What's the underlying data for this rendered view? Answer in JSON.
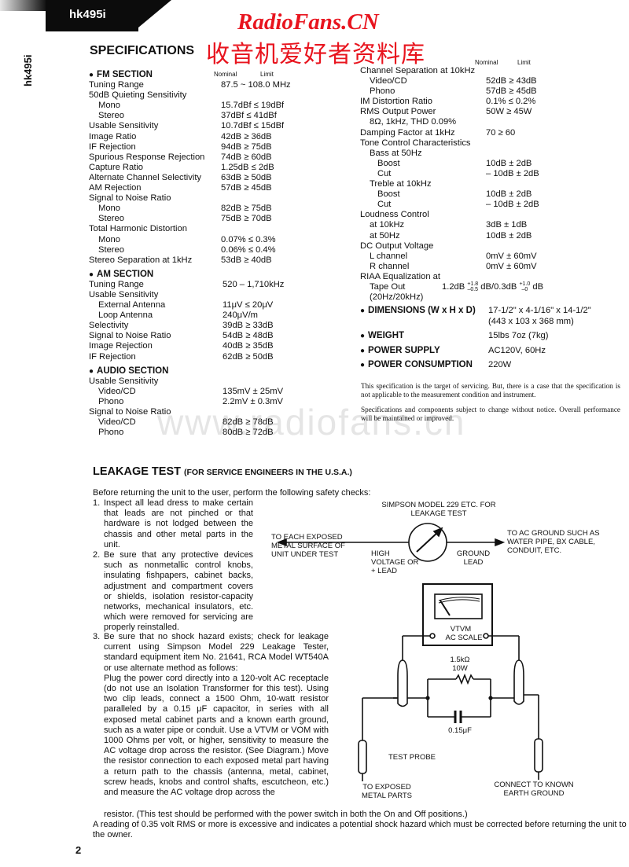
{
  "header": {
    "model_tab": "hk495i",
    "model_vertical": "hk495i",
    "title": "SPECIFICATIONS",
    "watermark_title": "RadioFans.CN",
    "watermark_cn": "收音机爱好者资料库",
    "watermark_url": "www.radiofans.cn"
  },
  "columns": {
    "nominal": "Nominal",
    "limit": "Limit"
  },
  "fm_section": {
    "title": "FM SECTION",
    "rows": [
      {
        "label": "Tuning Range",
        "value": "87.5 ~ 108.0 MHz",
        "indent": 0
      },
      {
        "label": "50dB Quieting Sensitivity",
        "value": "",
        "indent": 0
      },
      {
        "label": "Mono",
        "value": "15.7dBf ≤ 19dBf",
        "indent": 1
      },
      {
        "label": "Stereo",
        "value": "37dBf ≤ 41dBf",
        "indent": 1
      },
      {
        "label": "Usable Sensitivity",
        "value": "10.7dBf ≤ 15dBf",
        "indent": 0
      },
      {
        "label": "Image Ratio",
        "value": "42dB ≥ 36dB",
        "indent": 0
      },
      {
        "label": "IF Rejection",
        "value": "94dB ≥ 75dB",
        "indent": 0
      },
      {
        "label": "Spurious Response Rejection",
        "value": "74dB ≥ 60dB",
        "indent": 0
      },
      {
        "label": "Capture Ratio",
        "value": "1.25dB ≤ 2dB",
        "indent": 0
      },
      {
        "label": "Alternate Channel Selectivity",
        "value": "63dB ≥ 50dB",
        "indent": 0
      },
      {
        "label": "AM Rejection",
        "value": "57dB ≥ 45dB",
        "indent": 0
      },
      {
        "label": "Signal to Noise Ratio",
        "value": "",
        "indent": 0
      },
      {
        "label": "Mono",
        "value": "82dB ≥ 75dB",
        "indent": 1
      },
      {
        "label": "Stereo",
        "value": "75dB ≥ 70dB",
        "indent": 1
      },
      {
        "label": "Total Harmonic Distortion",
        "value": "",
        "indent": 0
      },
      {
        "label": "Mono",
        "value": "0.07% ≤ 0.3%",
        "indent": 1
      },
      {
        "label": "Stereo",
        "value": "0.06% ≤ 0.4%",
        "indent": 1
      },
      {
        "label": "Stereo Separation at 1kHz",
        "value": "53dB ≥ 40dB",
        "indent": 0
      }
    ]
  },
  "am_section": {
    "title": "AM SECTION",
    "rows": [
      {
        "label": "Tuning Range",
        "value": "520 – 1,710kHz",
        "indent": 0
      },
      {
        "label": "Usable Sensitivity",
        "value": "",
        "indent": 0
      },
      {
        "label": "External Antenna",
        "value": "11μV ≤ 20μV",
        "indent": 1
      },
      {
        "label": "Loop Antenna",
        "value": "240μV/m",
        "indent": 1
      },
      {
        "label": "Selectivity",
        "value": "39dB ≥ 33dB",
        "indent": 0
      },
      {
        "label": "Signal to Noise Ratio",
        "value": "54dB ≥ 48dB",
        "indent": 0
      },
      {
        "label": "Image Rejection",
        "value": "40dB ≥ 35dB",
        "indent": 0
      },
      {
        "label": "IF Rejection",
        "value": "62dB ≥ 50dB",
        "indent": 0
      }
    ]
  },
  "audio_section": {
    "title": "AUDIO SECTION",
    "rows": [
      {
        "label": "Usable Sensitivity",
        "value": "",
        "indent": 0
      },
      {
        "label": "Video/CD",
        "value": "135mV ± 25mV",
        "indent": 1
      },
      {
        "label": "Phono",
        "value": "2.2mV ± 0.3mV",
        "indent": 1
      },
      {
        "label": "Signal to Noise Ratio",
        "value": "",
        "indent": 0
      },
      {
        "label": "Video/CD",
        "value": "82dB ≥ 78dB",
        "indent": 1
      },
      {
        "label": "Phono",
        "value": "80dB ≥ 72dB",
        "indent": 1
      }
    ]
  },
  "audio_continued": {
    "rows": [
      {
        "label": "Channel Separation at 10kHz",
        "value": "",
        "indent": 0
      },
      {
        "label": "Video/CD",
        "value": "52dB ≥ 43dB",
        "indent": 1
      },
      {
        "label": "Phono",
        "value": "57dB ≥ 45dB",
        "indent": 1
      },
      {
        "label": "IM Distortion Ratio",
        "value": "0.1% ≤ 0.2%",
        "indent": 0
      },
      {
        "label": "RMS Output Power",
        "value": "50W ≥ 45W",
        "indent": 0
      },
      {
        "label": "8Ω, 1kHz, THD 0.09%",
        "value": "",
        "indent": 1
      },
      {
        "label": "Damping Factor at 1kHz",
        "value": "70 ≥ 60",
        "indent": 0
      },
      {
        "label": "Tone Control Characteristics",
        "value": "",
        "indent": 0
      },
      {
        "label": "Bass at 50Hz",
        "value": "",
        "indent": 1
      },
      {
        "label": "Boost",
        "value": "10dB ± 2dB",
        "indent": 2
      },
      {
        "label": "Cut",
        "value": "– 10dB ± 2dB",
        "indent": 2
      },
      {
        "label": "Treble at 10kHz",
        "value": "",
        "indent": 1
      },
      {
        "label": "Boost",
        "value": "10dB ± 2dB",
        "indent": 2
      },
      {
        "label": "Cut",
        "value": "– 10dB ± 2dB",
        "indent": 2
      },
      {
        "label": "Loudness Control",
        "value": "",
        "indent": 0
      },
      {
        "label": "at 10kHz",
        "value": "3dB ± 1dB",
        "indent": 1
      },
      {
        "label": "at 50Hz",
        "value": "10dB ± 2dB",
        "indent": 1
      },
      {
        "label": "DC Output Voltage",
        "value": "",
        "indent": 0
      },
      {
        "label": "L channel",
        "value": "0mV ± 60mV",
        "indent": 1
      },
      {
        "label": "R channel",
        "value": "0mV ± 60mV",
        "indent": 1
      },
      {
        "label": "RIAA Equalization at",
        "value": "",
        "indent": 0
      }
    ],
    "riaa": {
      "label": "Tape Out",
      "sublabel": "(20Hz/20kHz)",
      "v1": "1.2dB",
      "v1_plus": "+1.8",
      "v1_minus": "–0.5",
      "mid": "dB/0.3dB",
      "v2_plus": "+1.0",
      "v2_minus": "–0",
      "unit": "dB"
    }
  },
  "general": [
    {
      "label": "DIMENSIONS (W x H x D)",
      "value": "17-1/2\" x 4-1/16\" x 14-1/2\"",
      "value2": "(443 x 103 x 368 mm)"
    },
    {
      "label": "WEIGHT",
      "value": "15lbs 7oz (7kg)"
    },
    {
      "label": "POWER SUPPLY",
      "value": "AC120V, 60Hz"
    },
    {
      "label": "POWER CONSUMPTION",
      "value": "220W"
    }
  ],
  "notes": [
    "This specification is the target of servicing. But, there is a case that the specification is not applicable to the measurement condition and instrument.",
    "Specifications and components subject to change without notice. Overall performance will be maintained or improved."
  ],
  "leakage": {
    "title": "LEAKAGE TEST",
    "subtitle": "(FOR SERVICE ENGINEERS IN THE U.S.A.)",
    "intro": "Before returning the unit to the user, perform the following safety checks:",
    "items": [
      {
        "num": "1.",
        "text": "Inspect all lead dress to make certain that leads are not pinched or that hardware is not lodged between the chassis and other metal parts in the unit."
      },
      {
        "num": "2.",
        "text": "Be sure that any protective devices such as nonmetallic control knobs, insulating fishpapers, cabinet backs, adjustment and compartment covers or shields, isolation resistor-capacity networks, mechanical insulators, etc. which were removed for servicing are properly reinstalled."
      },
      {
        "num": "3.",
        "text": "Be sure that no shock hazard exists; check for leakage current using Simpson Model 229 Leakage Tester, standard equipment item No. 21641, RCA Model WT540A or use alternate method as follows:"
      }
    ],
    "method": "Plug the power cord directly into a 120-volt AC receptacle (do not use an Isolation Transformer for this test). Using two clip leads, connect a 1500 Ohm, 10-watt resistor paralleled by a 0.15 μF capacitor, in series with all exposed metal cabinet parts and a known earth ground, such as a water pipe or conduit. Use a VTVM or VOM with 1000 Ohms per volt, or higher, sensitivity to measure the AC voltage drop across the resistor. (See Diagram.) Move the resistor connection to each exposed metal part having a return path to the chassis (antenna, metal, cabinet, screw heads, knobs and control shafts, escutcheon, etc.) and measure the AC voltage drop across the",
    "method_tail": "resistor. (This test should be performed with the power switch in both the On and Off positions.)",
    "warning": "A reading of 0.35 volt RMS or more is excessive and indicates a potential shock hazard which must be corrected before returning the unit to the owner.",
    "diagram": {
      "tester_label": "SIMPSON MODEL 229 ETC. FOR LEAKAGE TEST",
      "left_label": "TO EACH EXPOSED METAL SURFACE OF UNIT UNDER TEST",
      "high_lead": "HIGH VOLTAGE OR + LEAD",
      "ground_lead": "GROUND LEAD",
      "right_label": "TO AC GROUND SUCH AS WATER PIPE, BX CABLE, CONDUIT, ETC.",
      "vtvm_label": "VTVM",
      "ac_scale": "AC SCALE",
      "resistor_value": "1.5kΩ",
      "resistor_watt": "10W",
      "capacitor_value": "0.15μF",
      "test_probe": "TEST PROBE",
      "exposed_parts": "TO EXPOSED METAL PARTS",
      "earth_ground": "CONNECT TO KNOWN EARTH GROUND"
    }
  },
  "page_number": "2"
}
